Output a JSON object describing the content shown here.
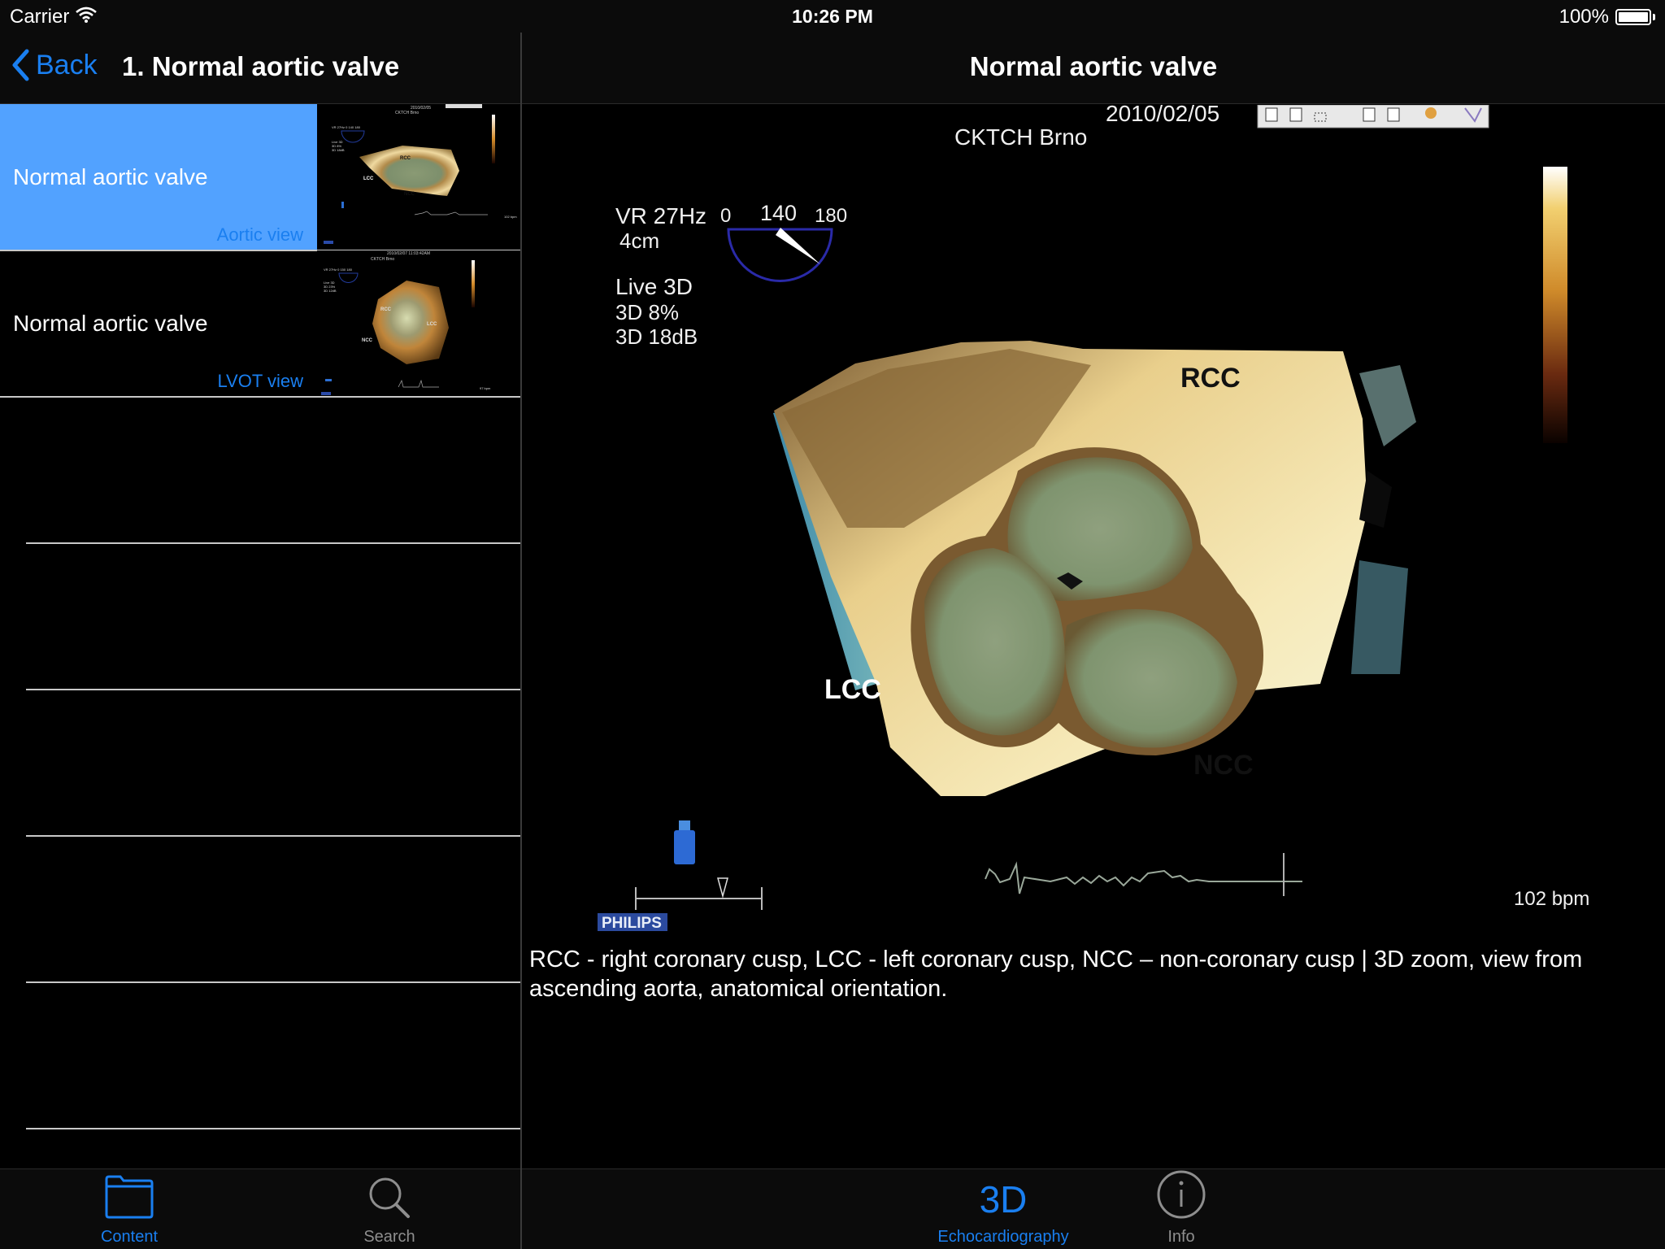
{
  "status_bar": {
    "carrier": "Carrier",
    "time": "10:26 PM",
    "battery_percent_label": "100%",
    "battery_level": 1.0
  },
  "left_nav": {
    "back_label": "Back",
    "title": "1. Normal aortic valve"
  },
  "list": {
    "items": [
      {
        "title": "Normal aortic valve",
        "subtitle": "Aortic view",
        "selected": true,
        "thumb": {
          "date": "2010/02/05",
          "site": "CKTCH Brno",
          "labels": [
            "RCC",
            "LCC",
            "NCC"
          ],
          "bpm": "102 bpm"
        }
      },
      {
        "title": "Normal aortic valve",
        "subtitle": "LVOT view",
        "selected": false,
        "thumb": {
          "date": "2010/02/07  11:03:42AM",
          "site": "CKTCH Brno",
          "labels": [
            "RCC",
            "LCC",
            "NCC"
          ],
          "bpm": "97 bpm"
        }
      }
    ]
  },
  "right_nav": {
    "title": "Normal aortic valve"
  },
  "echo": {
    "date": "2010/02/05",
    "site": "CKTCH Brno",
    "vr": "VR 27Hz",
    "depth": "4cm",
    "angle_min": "0",
    "angle_value": "140",
    "angle_max": "180",
    "mode": "Live 3D",
    "gain": "3D 8%",
    "compression": "3D 18dB",
    "label_rcc": "RCC",
    "label_lcc": "LCC",
    "label_ncc": "NCC",
    "heart_rate": "102 bpm",
    "brand": "PHILIPS"
  },
  "caption": "RCC - right coronary cusp, LCC - left coronary cusp, NCC – non-coronary cusp | 3D zoom, view from ascending aorta, anatomical orientation.",
  "tabs_left": [
    {
      "label": "Content",
      "icon": "folder-icon",
      "active": true
    },
    {
      "label": "Search",
      "icon": "search-icon",
      "active": false
    }
  ],
  "tabs_right": [
    {
      "label": "Echocardiography",
      "glyph": "3D",
      "icon": "3d-icon",
      "active": true
    },
    {
      "label": "Info",
      "icon": "info-icon",
      "active": false
    }
  ],
  "colors": {
    "accent": "#1a7ff0",
    "selected_row": "#52a2ff",
    "inactive_tab": "#8e8e8e"
  }
}
